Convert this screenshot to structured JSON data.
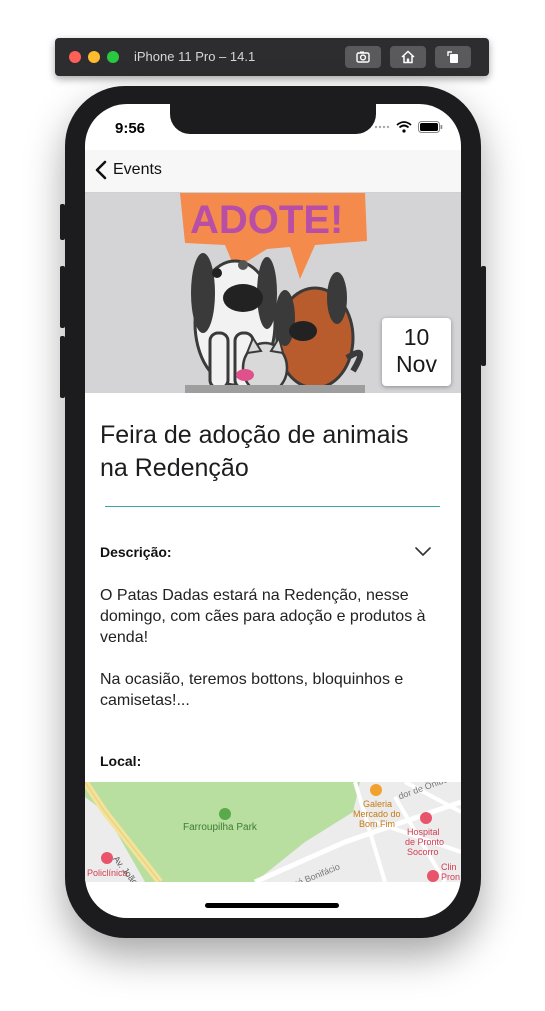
{
  "simulator": {
    "title": "iPhone 11 Pro – 14.1"
  },
  "status_bar": {
    "time": "9:56"
  },
  "nav": {
    "back_label": "Events"
  },
  "hero": {
    "banner_text": "ADOTE!",
    "date_day": "10",
    "date_month": "Nov"
  },
  "event": {
    "title": "Feira de adoção de animais na Redenção",
    "description_label": "Descrição:",
    "description": "O Patas Dadas estará na Redenção, nesse domingo, com cães para adoção e produtos à venda!\n\nNa ocasião, teremos bottons, bloquinhos e camisetas!...",
    "location_label": "Local:"
  },
  "map": {
    "park": "Farroupilha Park",
    "poi_1": "Galeria",
    "poi_1b": "Mercado do",
    "poi_1c": "Bom Fim",
    "poi_2": "Hospital",
    "poi_2b": "de Pronto",
    "poi_2c": "Socorro",
    "poi_3": "Policlínica",
    "poi_4": "Clin",
    "poi_4b": "Pron",
    "street_1": "Av. João Pe",
    "street_2": "José Bonifácio",
    "street_3": "dor de Ônibus"
  },
  "colors": {
    "accent_divider": "#3aa7a1",
    "banner_orange": "#f48a4c",
    "banner_purple": "#b84ea6"
  }
}
